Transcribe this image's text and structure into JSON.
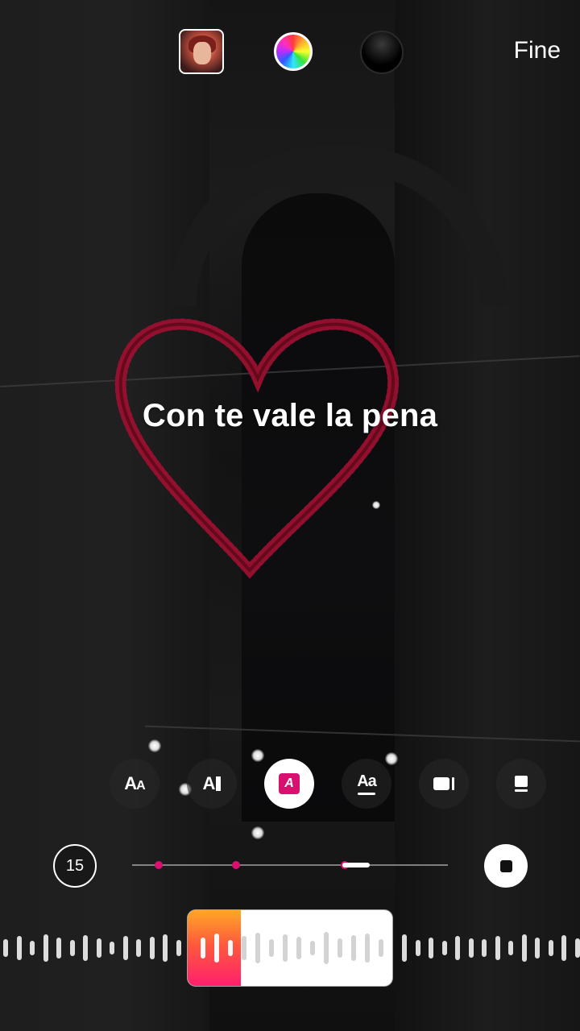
{
  "top_bar": {
    "done_label": "Fine"
  },
  "caption": {
    "text": "Con te vale la pena"
  },
  "style_toolbar": {
    "buttons": [
      {
        "name": "font-style-aa",
        "label": "Aa"
      },
      {
        "name": "text-align",
        "label": "A"
      },
      {
        "name": "text-effect-highlight",
        "label": "A"
      },
      {
        "name": "text-size-aa",
        "label": "Aa"
      },
      {
        "name": "video-style",
        "label": ""
      },
      {
        "name": "card-style",
        "label": ""
      }
    ],
    "active_index": 2
  },
  "timeline": {
    "duration": "15",
    "progress": 0.67
  },
  "waveform": {
    "selection_progress": 0.26
  },
  "colors": {
    "accent": "#d8106f",
    "progress_start": "#ffa726",
    "progress_end": "#ff1f6d"
  }
}
